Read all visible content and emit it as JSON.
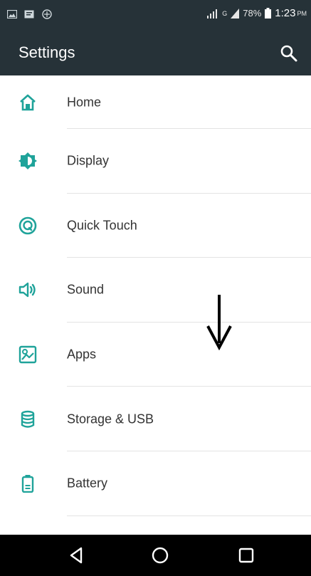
{
  "status_bar": {
    "battery_percent": "78%",
    "time": "1:23",
    "ampm": "PM",
    "network_label": "G"
  },
  "toolbar": {
    "title": "Settings"
  },
  "settings_items": [
    {
      "label": "Home",
      "icon": "home-icon"
    },
    {
      "label": "Display",
      "icon": "brightness-icon"
    },
    {
      "label": "Quick Touch",
      "icon": "quick-touch-icon"
    },
    {
      "label": "Sound",
      "icon": "speaker-icon"
    },
    {
      "label": "Apps",
      "icon": "apps-icon"
    },
    {
      "label": "Storage & USB",
      "icon": "storage-icon"
    },
    {
      "label": "Battery",
      "icon": "battery-icon"
    }
  ],
  "colors": {
    "bar": "#263238",
    "accent": "#1fa39a",
    "text": "#333333",
    "divider": "#e3e3e3"
  }
}
